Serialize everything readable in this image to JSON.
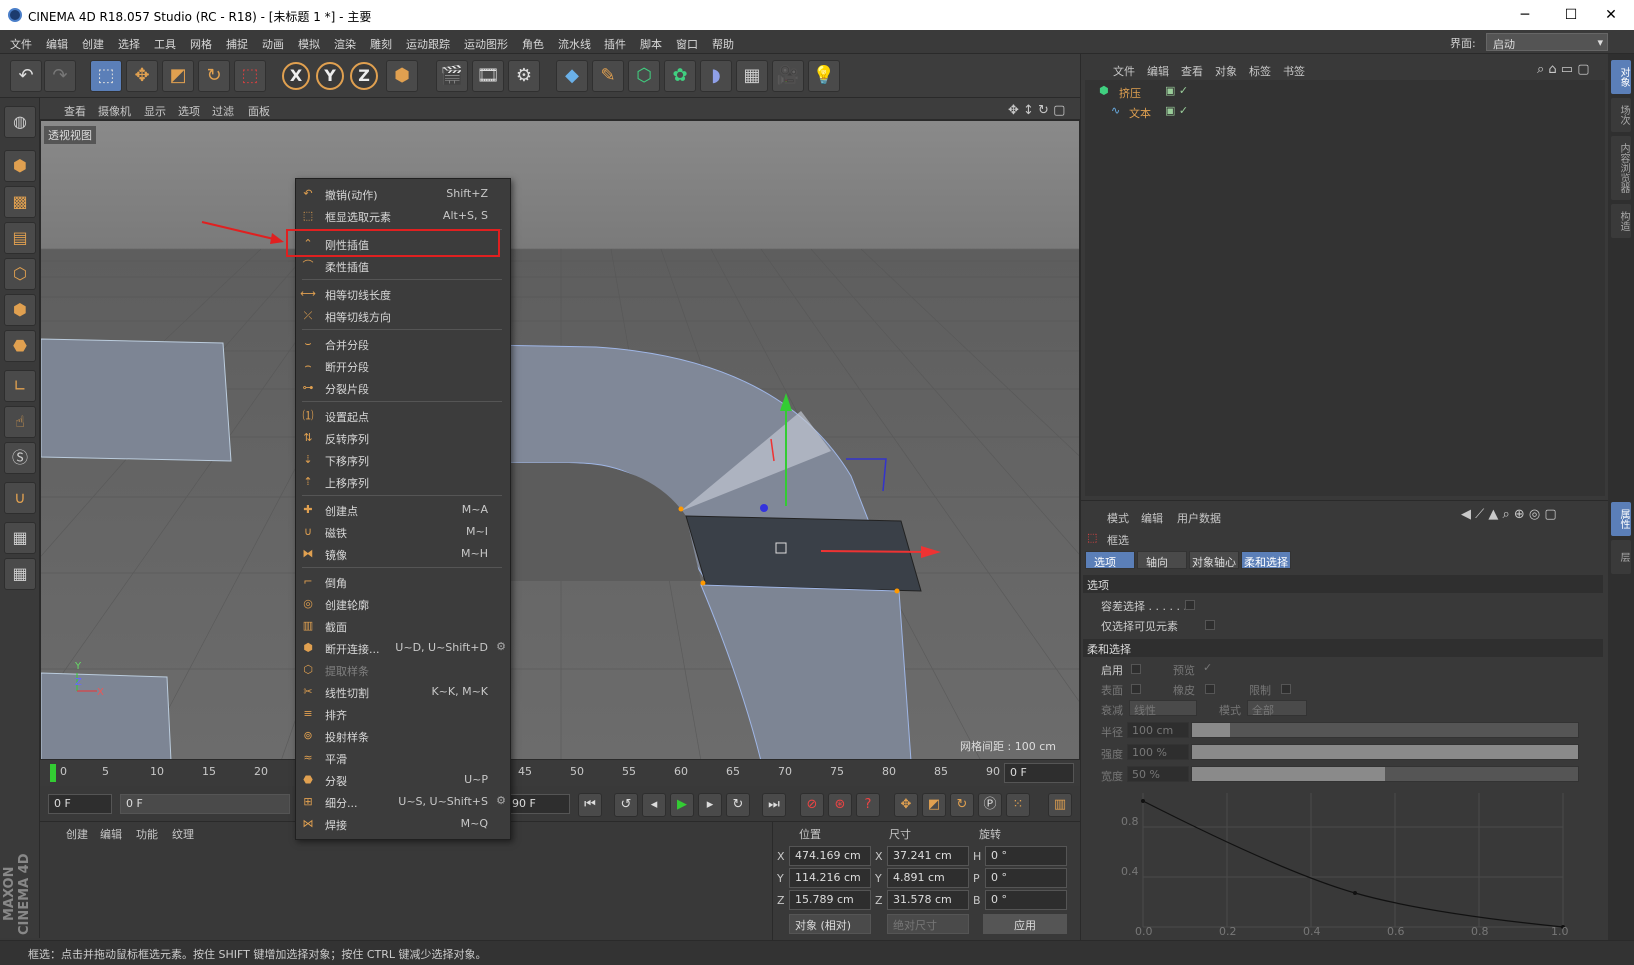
{
  "window": {
    "title": "CINEMA 4D R18.057 Studio (RC - R18) - [未标题 1 *] - 主要"
  },
  "menubar": {
    "items": [
      "文件",
      "编辑",
      "创建",
      "选择",
      "工具",
      "网格",
      "捕捉",
      "动画",
      "模拟",
      "渲染",
      "雕刻",
      "运动跟踪",
      "运动图形",
      "角色",
      "流水线",
      "插件",
      "脚本",
      "窗口",
      "帮助"
    ],
    "layout_label": "界面:",
    "layout_value": "启动"
  },
  "viewport": {
    "menu": [
      "查看",
      "摄像机",
      "显示",
      "选项",
      "过滤",
      "面板"
    ],
    "view_label": "透视视图",
    "grid_spacing": "网格间距 : 100 cm",
    "axis_y": "Y",
    "axis_z": "Z",
    "axis_x": "X"
  },
  "context_menu": {
    "items": [
      {
        "icon": "undo-icon",
        "label": "撤销(动作)",
        "shortcut": "Shift+Z"
      },
      {
        "icon": "frame-select-icon",
        "label": "框显选取元素",
        "shortcut": "Alt+S, S"
      },
      {
        "icon": "hard-interp-icon",
        "label": "刚性插值",
        "shortcut": ""
      },
      {
        "icon": "soft-interp-icon",
        "label": "柔性插值",
        "shortcut": ""
      },
      {
        "icon": "equal-tangent-length-icon",
        "label": "相等切线长度",
        "shortcut": ""
      },
      {
        "icon": "equal-tangent-dir-icon",
        "label": "相等切线方向",
        "shortcut": ""
      },
      {
        "icon": "join-segment-icon",
        "label": "合并分段",
        "shortcut": ""
      },
      {
        "icon": "break-segment-icon",
        "label": "断开分段",
        "shortcut": ""
      },
      {
        "icon": "explode-segments-icon",
        "label": "分裂片段",
        "shortcut": ""
      },
      {
        "icon": "set-first-point-icon",
        "label": "设置起点",
        "shortcut": ""
      },
      {
        "icon": "reverse-sequence-icon",
        "label": "反转序列",
        "shortcut": ""
      },
      {
        "icon": "move-down-sequence-icon",
        "label": "下移序列",
        "shortcut": ""
      },
      {
        "icon": "move-up-sequence-icon",
        "label": "上移序列",
        "shortcut": ""
      },
      {
        "icon": "create-point-icon",
        "label": "创建点",
        "shortcut": "M~A"
      },
      {
        "icon": "magnet-icon",
        "label": "磁铁",
        "shortcut": "M~I"
      },
      {
        "icon": "mirror-icon",
        "label": "镜像",
        "shortcut": "M~H"
      },
      {
        "icon": "chamfer-icon",
        "label": "倒角",
        "shortcut": ""
      },
      {
        "icon": "create-outline-icon",
        "label": "创建轮廓",
        "shortcut": ""
      },
      {
        "icon": "cross-section-icon",
        "label": "截面",
        "shortcut": ""
      },
      {
        "icon": "disconnect-icon",
        "label": "断开连接...",
        "shortcut": "U~D, U~Shift+D"
      },
      {
        "icon": "extract-spline-icon",
        "label": "提取样条",
        "shortcut": ""
      },
      {
        "icon": "line-cut-icon",
        "label": "线性切割",
        "shortcut": "K~K, M~K"
      },
      {
        "icon": "arrange-icon",
        "label": "排齐",
        "shortcut": ""
      },
      {
        "icon": "project-spline-icon",
        "label": "投射样条",
        "shortcut": ""
      },
      {
        "icon": "smooth-icon",
        "label": "平滑",
        "shortcut": ""
      },
      {
        "icon": "split-icon",
        "label": "分裂",
        "shortcut": "U~P"
      },
      {
        "icon": "subdivide-icon",
        "label": "细分...",
        "shortcut": "U~S, U~Shift+S"
      },
      {
        "icon": "weld-icon",
        "label": "焊接",
        "shortcut": "M~Q"
      }
    ]
  },
  "timeline": {
    "ticks": [
      "0",
      "5",
      "10",
      "15",
      "20",
      "45",
      "50",
      "55",
      "60",
      "65",
      "70",
      "75",
      "80",
      "85",
      "90"
    ],
    "end_frame": "0 F",
    "start_field": "0 F",
    "min_field": "0 F",
    "max_field": "90 F"
  },
  "material_panel": {
    "menu": [
      "创建",
      "编辑",
      "功能",
      "纹理"
    ]
  },
  "coords": {
    "headers": [
      "位置",
      "尺寸",
      "旋转"
    ],
    "rows": [
      {
        "axis": "X",
        "pos": "474.169 cm",
        "size_axis": "X",
        "size": "37.241 cm",
        "rot_axis": "H",
        "rot": "0 °"
      },
      {
        "axis": "Y",
        "pos": "114.216 cm",
        "size_axis": "Y",
        "size": "4.891 cm",
        "rot_axis": "P",
        "rot": "0 °"
      },
      {
        "axis": "Z",
        "pos": "15.789 cm",
        "size_axis": "Z",
        "size": "31.578 cm",
        "rot_axis": "B",
        "rot": "0 °"
      }
    ],
    "mode_select": "对象 (相对)",
    "size_select": "绝对尺寸",
    "apply_button": "应用"
  },
  "object_manager": {
    "menu": [
      "文件",
      "编辑",
      "查看",
      "对象",
      "标签",
      "书签"
    ],
    "objects": [
      {
        "name": "挤压"
      },
      {
        "name": "文本"
      }
    ]
  },
  "attribute_manager": {
    "menu": [
      "模式",
      "编辑",
      "用户数据"
    ],
    "tool_name": "框选",
    "tabs": [
      "选项",
      "轴向",
      "对象轴心",
      "柔和选择"
    ],
    "section_options": "选项",
    "tolerant": "容差选择 . . . . . .",
    "visible_only": "仅选择可见元素",
    "section_soft": "柔和选择",
    "enable": "启用",
    "preview": "预览",
    "surface": "表面",
    "rubber": "橡皮",
    "restrict": "限制",
    "falloff_label": "衰减",
    "falloff_value": "线性",
    "mode_label": "模式",
    "mode_value": "全部",
    "radius_label": "半径",
    "radius_value": "100 cm",
    "strength_label": "强度",
    "strength_value": "100 %",
    "strength": 1.0,
    "width_label": "宽度",
    "width_value": "50 %",
    "width": 0.5,
    "graph_y": [
      "0.8",
      "0.4"
    ],
    "graph_x": [
      "0.0",
      "0.2",
      "0.4",
      "0.6",
      "0.8",
      "1.0"
    ]
  },
  "right_tabs": [
    "对象",
    "场次",
    "内容浏览器",
    "构造"
  ],
  "right_tabs_lower": [
    "属性",
    "层"
  ],
  "status": "框选：点击并拖动鼠标框选元素。按住 SHIFT 键增加选择对象；按住 CTRL 键减少选择对象。",
  "brand": "MAXON CINEMA 4D"
}
